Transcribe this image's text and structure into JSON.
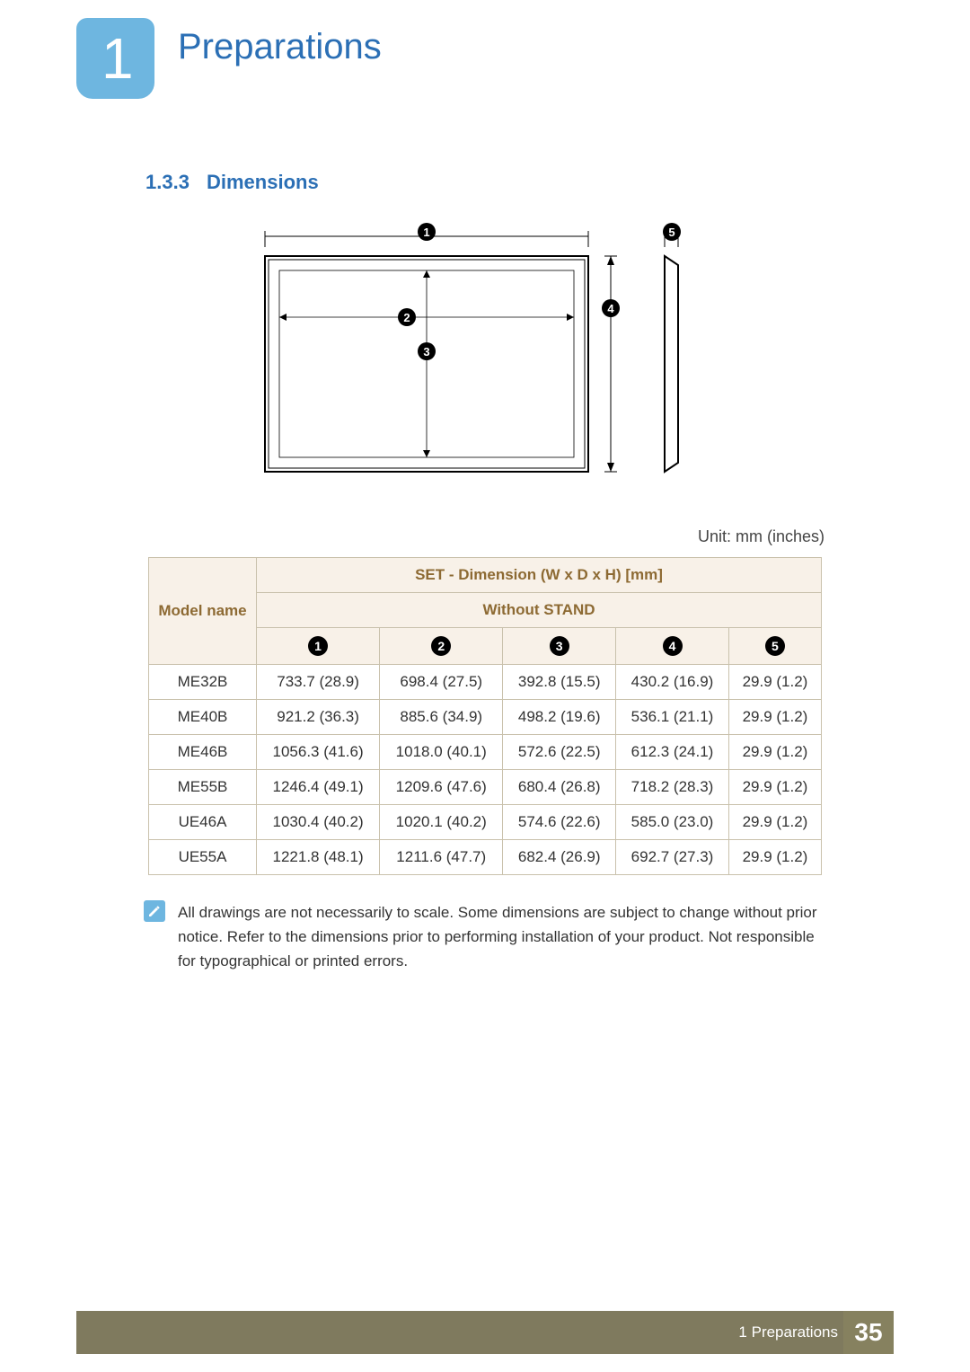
{
  "chapter": {
    "number": "1",
    "title": "Preparations"
  },
  "subsection": {
    "number": "1.3.3",
    "title": "Dimensions"
  },
  "diagram": {
    "markers": [
      "1",
      "2",
      "3",
      "4",
      "5"
    ]
  },
  "unit_label": "Unit: mm (inches)",
  "table": {
    "model_header": "Model name",
    "set_header": "SET - Dimension (W x D x H) [mm]",
    "without_stand": "Without STAND",
    "num_cols": [
      "1",
      "2",
      "3",
      "4",
      "5"
    ],
    "rows": [
      {
        "model": "ME32B",
        "d1": "733.7 (28.9)",
        "d2": "698.4 (27.5)",
        "d3": "392.8 (15.5)",
        "d4": "430.2 (16.9)",
        "d5": "29.9 (1.2)"
      },
      {
        "model": "ME40B",
        "d1": "921.2 (36.3)",
        "d2": "885.6 (34.9)",
        "d3": "498.2 (19.6)",
        "d4": "536.1 (21.1)",
        "d5": "29.9 (1.2)"
      },
      {
        "model": "ME46B",
        "d1": "1056.3 (41.6)",
        "d2": "1018.0 (40.1)",
        "d3": "572.6 (22.5)",
        "d4": "612.3 (24.1)",
        "d5": "29.9 (1.2)"
      },
      {
        "model": "ME55B",
        "d1": "1246.4 (49.1)",
        "d2": "1209.6 (47.6)",
        "d3": "680.4 (26.8)",
        "d4": "718.2 (28.3)",
        "d5": "29.9 (1.2)"
      },
      {
        "model": "UE46A",
        "d1": "1030.4 (40.2)",
        "d2": "1020.1 (40.2)",
        "d3": "574.6 (22.6)",
        "d4": "585.0 (23.0)",
        "d5": "29.9 (1.2)"
      },
      {
        "model": "UE55A",
        "d1": "1221.8 (48.1)",
        "d2": "1211.6 (47.7)",
        "d3": "682.4 (26.9)",
        "d4": "692.7 (27.3)",
        "d5": "29.9 (1.2)"
      }
    ]
  },
  "note": "All drawings are not necessarily to scale. Some dimensions are subject to change without prior notice. Refer to the dimensions prior to performing installation of your product. Not responsible for typographical or printed errors.",
  "footer": {
    "chapter_ref": "1 Preparations",
    "page_number": "35"
  }
}
